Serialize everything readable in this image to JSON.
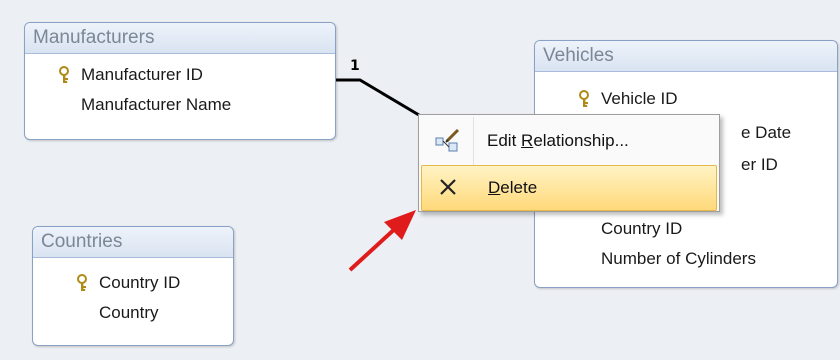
{
  "tables": {
    "manufacturers": {
      "title": "Manufacturers",
      "fields": [
        "Manufacturer ID",
        "Manufacturer Name"
      ]
    },
    "vehicles": {
      "title": "Vehicles",
      "fields": [
        "Vehicle ID",
        "e Date",
        "er ID",
        "Country ID",
        "Number of Cylinders"
      ]
    },
    "countries": {
      "title": "Countries",
      "fields": [
        "Country ID",
        "Country"
      ]
    }
  },
  "relationship": {
    "label": "1"
  },
  "context_menu": {
    "edit": {
      "before": "Edit ",
      "key": "R",
      "after": "elationship...",
      "icon": "edit-relationship-icon"
    },
    "delete": {
      "key": "D",
      "after": "elete",
      "icon": "delete-x-icon"
    }
  },
  "colors": {
    "accent_arrow": "#e01b1b",
    "highlight": "#ffd97a",
    "table_border": "#8aa1c6"
  }
}
